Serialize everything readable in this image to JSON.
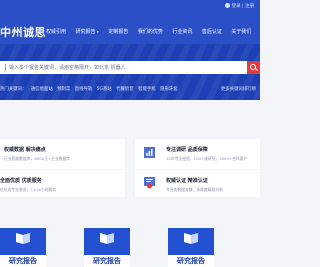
{
  "header": {
    "user_links": "登录 | 注册",
    "logo": "中州诚思",
    "nav": [
      "权威引用",
      "研究报告",
      "定制报告",
      "我们的优势",
      "行业资讯",
      "售后认证",
      "关于我们"
    ]
  },
  "search": {
    "placeholder": "输入多个报告关键词，请用空格隔开，如北京 机器人",
    "hot_label": "热门关键词：",
    "hot_keywords": [
      "通信地面站",
      "预制菜",
      "直线导轨",
      "5G基站",
      "代餐奶昔",
      "智能手机",
      "隐形牙套"
    ],
    "more_link": "更多关键词排行榜"
  },
  "features": [
    {
      "title": "权威数据 解决痛点",
      "subtitle": "行业权威数据库，8000万+企业数据库"
    },
    {
      "title": "专注调研 品质保障",
      "subtitle": "15年专注经验，100+调研员，1000+合作客户"
    },
    {
      "title": "全面优质 优质服务",
      "subtitle": "优化的专业服务，7×24小时服务"
    },
    {
      "title": "权威认证 精准认证",
      "subtitle": "专业的数据支撑，多维度精准分析"
    }
  ],
  "reports": [
    {
      "title": "研究报告"
    },
    {
      "title": "研究报告"
    },
    {
      "title": "研究报告"
    }
  ],
  "colors": {
    "brand": "#2b4fc7",
    "band": "#1e40b7",
    "search_button": "#e23c3c"
  }
}
